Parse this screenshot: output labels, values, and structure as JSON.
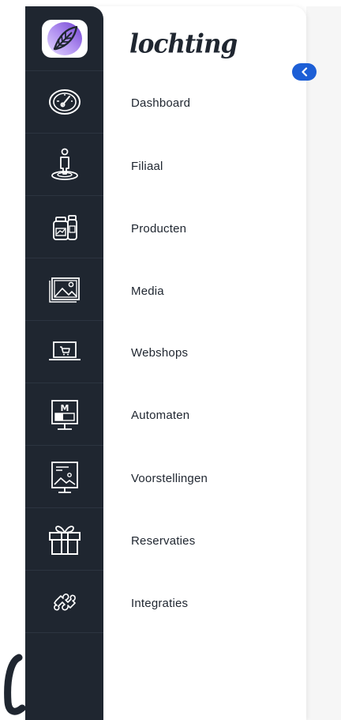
{
  "brand": {
    "name": "lochting"
  },
  "sidebar": {
    "items": [
      {
        "label": "Dashboard",
        "icon": "gauge-icon"
      },
      {
        "label": "Filiaal",
        "icon": "person-location-icon"
      },
      {
        "label": "Producten",
        "icon": "products-icon"
      },
      {
        "label": "Media",
        "icon": "image-icon"
      },
      {
        "label": "Webshops",
        "icon": "laptop-cart-icon"
      },
      {
        "label": "Automaten",
        "icon": "vending-monitor-icon"
      },
      {
        "label": "Voorstellingen",
        "icon": "presentation-icon"
      },
      {
        "label": "Reservaties",
        "icon": "gift-icon"
      },
      {
        "label": "Integraties",
        "icon": "puzzle-icon"
      }
    ]
  },
  "toggle": {
    "icon": "chevron-left-icon"
  },
  "colors": {
    "rail": "#1f2630",
    "accent": "#1d5fd6",
    "logo_gradient_start": "#c9b8f0",
    "logo_gradient_end": "#7a4fd8",
    "text": "#1f2630"
  }
}
